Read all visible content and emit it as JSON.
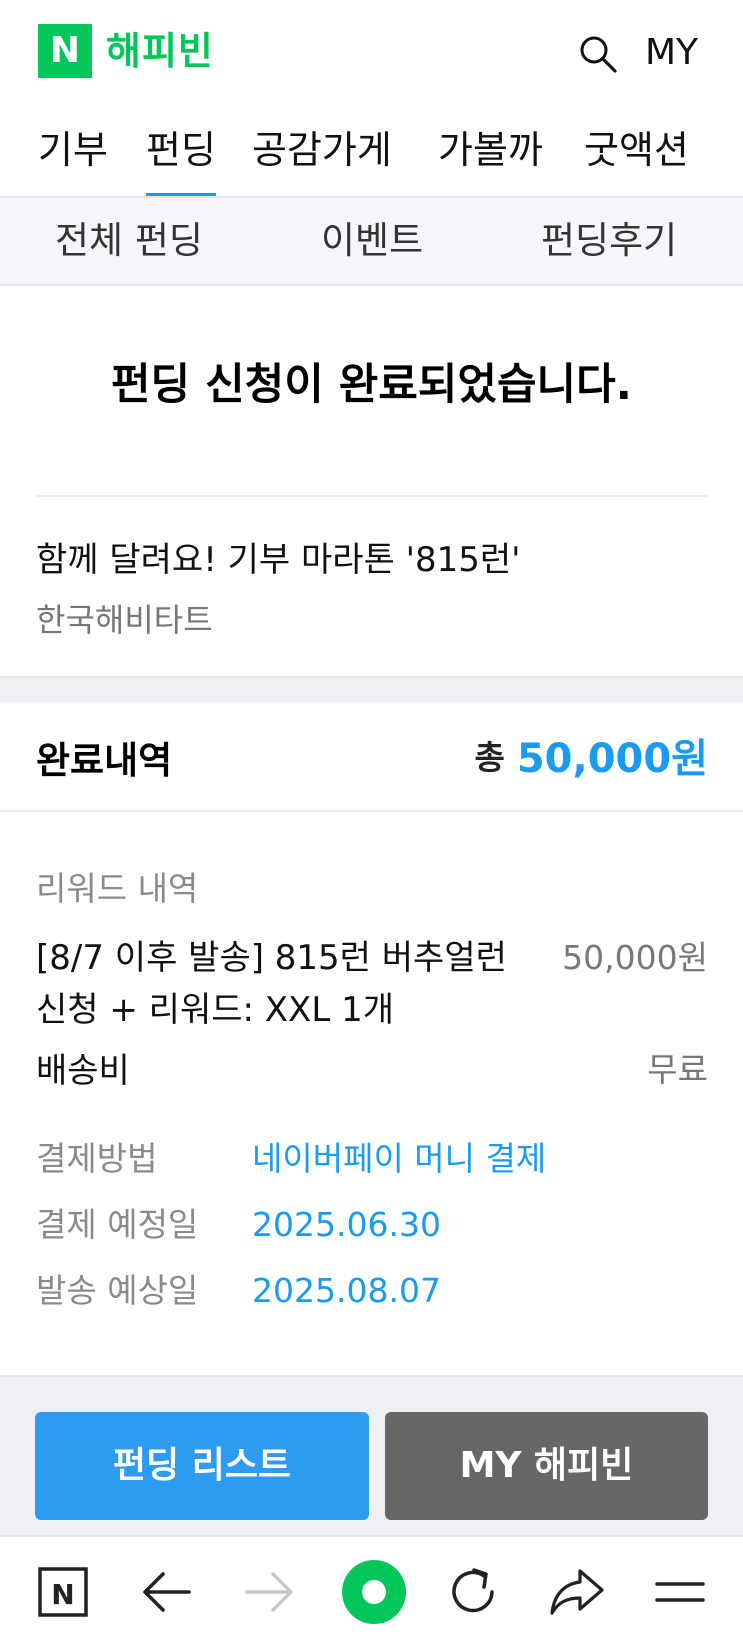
{
  "header": {
    "logo_letter": "N",
    "logo_text": "해피빈",
    "search_icon": "search-icon",
    "my_label": "MY"
  },
  "main_nav": {
    "tabs": [
      {
        "label": "기부",
        "active": false
      },
      {
        "label": "펀딩",
        "active": true
      },
      {
        "label": "공감가게",
        "active": false
      },
      {
        "label": "가볼까",
        "active": false
      },
      {
        "label": "굿액션",
        "active": false
      }
    ]
  },
  "sub_nav": {
    "items": [
      {
        "label": "전체 펀딩"
      },
      {
        "label": "이벤트"
      },
      {
        "label": "펀딩후기"
      }
    ]
  },
  "completion": {
    "title": "펀딩 신청이 완료되었습니다.",
    "project_title": "함께 달려요! 기부 마라톤 '815런'",
    "organization": "한국해비타트"
  },
  "summary": {
    "label": "완료내역",
    "total_prefix": "총",
    "total_amount": "50,000원"
  },
  "details": {
    "reward_heading": "리워드 내역",
    "reward_line1": "[8/7 이후 발송] 815런 버추얼런",
    "reward_line2": "신청 + 리워드: XXL 1개",
    "reward_price": "50,000원",
    "shipping_label": "배송비",
    "shipping_value": "무료",
    "payment_method_label": "결제방법",
    "payment_method_value": "네이버페이 머니 결제",
    "payment_date_label": "결제 예정일",
    "payment_date_value": "2025.06.30",
    "ship_date_label": "발송 예상일",
    "ship_date_value": "2025.08.07"
  },
  "buttons": {
    "funding_list": "펀딩 리스트",
    "my_happybean": "MY 해피빈"
  },
  "toolbar": {
    "home_letter": "N",
    "icons": [
      "naver-home-icon",
      "back-arrow-icon",
      "forward-arrow-icon",
      "green-dot-icon",
      "refresh-icon",
      "share-icon",
      "menu-icon"
    ]
  },
  "colors": {
    "brand_green": "#03c75a",
    "accent_blue": "#1a9bf0",
    "button_blue": "#2d9bf0",
    "button_gray": "#676767"
  }
}
